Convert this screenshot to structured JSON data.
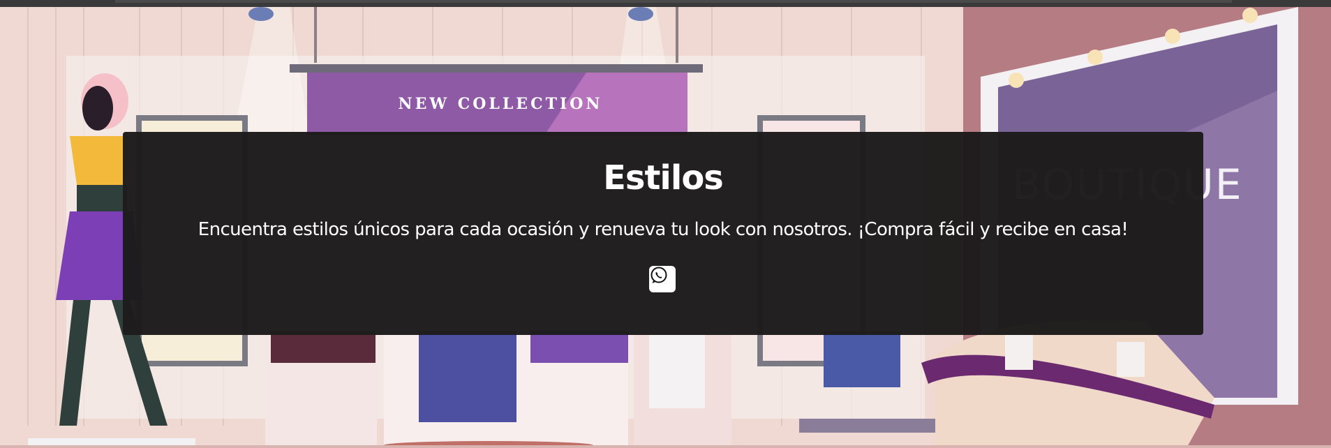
{
  "hero": {
    "banner_text": "NEW  COLLECTION",
    "sign_text": "BOUTIQUE",
    "title": "Estilos",
    "description": "Encuentra estilos únicos para cada ocasión y renueva tu look con nosotros. ¡Compra fácil y recibe en casa!",
    "whatsapp_icon": "whatsapp-icon"
  },
  "colors": {
    "overlay": "#1e1c1c",
    "banner": "#8e5aa6",
    "accent_purple": "#6b3fa0"
  }
}
